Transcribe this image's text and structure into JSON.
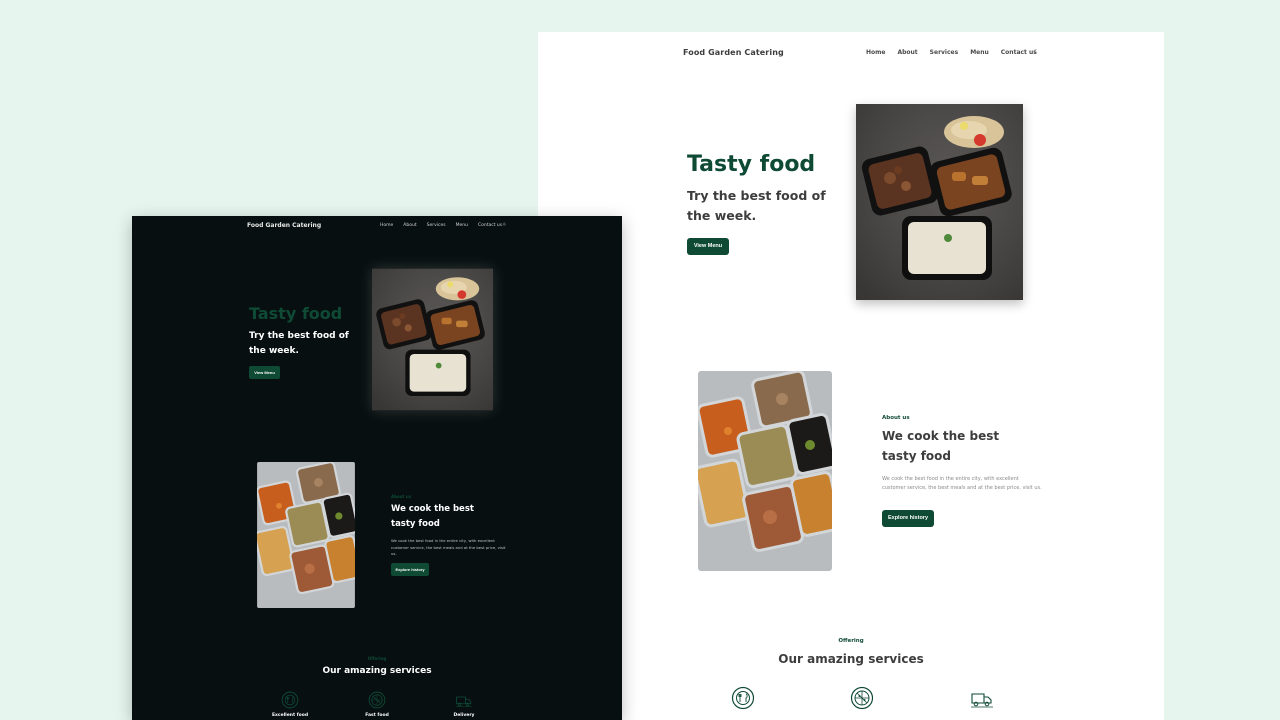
{
  "light": {
    "logo": "Food Garden Catering",
    "nav": [
      "Home",
      "About",
      "Services",
      "Menu",
      "Contact us"
    ],
    "theme_icon": "moon-icon",
    "hero": {
      "title": "Tasty food",
      "subtitle": "Try the best food of the week.",
      "button": "View Menu"
    },
    "about": {
      "eyebrow": "About us",
      "title": "We cook the best tasty food",
      "text": "We cook the best food in the entire city, with excellent customer service, the best meals and at the best price, visit us.",
      "button": "Explore history"
    },
    "services": {
      "eyebrow": "Offering",
      "title": "Our amazing services",
      "icons": [
        "dinner-plate-icon",
        "pizza-icon",
        "delivery-truck-icon"
      ]
    }
  },
  "dark": {
    "logo": "Food Garden Catering",
    "nav": [
      "Home",
      "About",
      "Services",
      "Menu",
      "Contact us"
    ],
    "theme_icon": "sun-icon",
    "hero": {
      "title": "Tasty food",
      "subtitle": "Try the best food of the week.",
      "button": "View Menu"
    },
    "about": {
      "eyebrow": "About us",
      "title": "We cook the best tasty food",
      "text": "We cook the best food in the entire city, with excellent customer service, the best meals and at the best price, visit us.",
      "button": "Explore history"
    },
    "services": {
      "eyebrow": "Offering",
      "title": "Our amazing services",
      "items": [
        {
          "label": "Excellent food",
          "icon": "dinner-plate-icon"
        },
        {
          "label": "Fast food",
          "icon": "pizza-icon"
        },
        {
          "label": "Delivery",
          "icon": "delivery-truck-icon"
        }
      ]
    }
  },
  "colors": {
    "background": "#e6f6ef",
    "accent": "#0f4a35",
    "dark_bg": "#070f10"
  }
}
